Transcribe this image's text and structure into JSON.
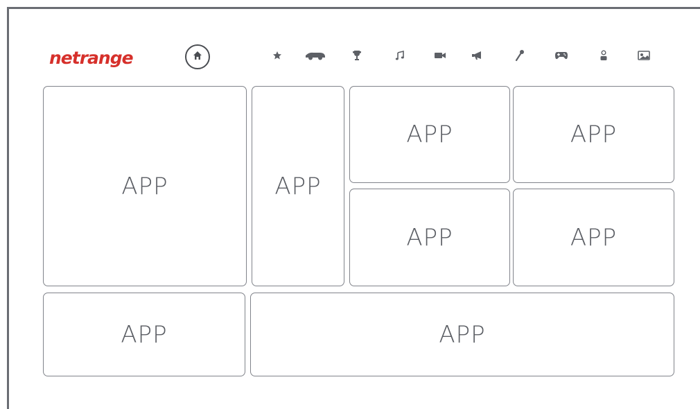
{
  "header": {
    "logo_text": "netrange",
    "logo_color": "#d6302b",
    "home_icon": "home-icon",
    "categories": [
      {
        "name": "favorites",
        "icon": "star-icon"
      },
      {
        "name": "sports",
        "icon": "car-icon"
      },
      {
        "name": "awards",
        "icon": "trophy-icon"
      },
      {
        "name": "music",
        "icon": "music-note-icon"
      },
      {
        "name": "video",
        "icon": "video-camera-icon"
      },
      {
        "name": "news",
        "icon": "megaphone-icon"
      },
      {
        "name": "karaoke",
        "icon": "microphone-icon"
      },
      {
        "name": "games",
        "icon": "gamepad-icon"
      },
      {
        "name": "kids",
        "icon": "person-icon"
      },
      {
        "name": "photos",
        "icon": "photo-icon"
      }
    ]
  },
  "tiles": [
    {
      "label": "APP"
    },
    {
      "label": "APP"
    },
    {
      "label": "APP"
    },
    {
      "label": "APP"
    },
    {
      "label": "APP"
    },
    {
      "label": "APP"
    },
    {
      "label": "APP"
    },
    {
      "label": "APP"
    }
  ]
}
